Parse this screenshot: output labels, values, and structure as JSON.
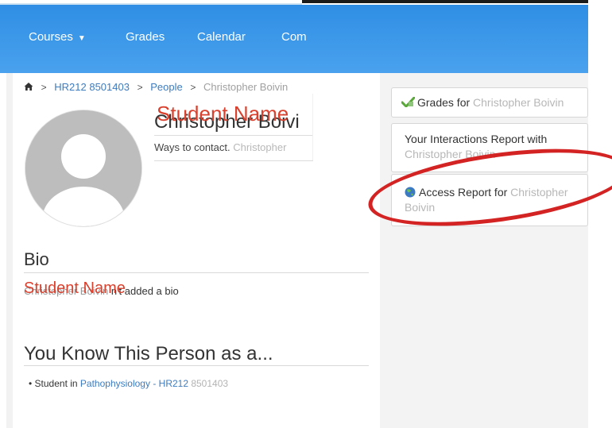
{
  "nav": {
    "courses_label": "Courses",
    "grades_label": "Grades",
    "calendar_label": "Calendar",
    "comm_label": "Com"
  },
  "breadcrumb": {
    "course": "HR212 8501403",
    "people": "People",
    "person": "Christopher Boivin"
  },
  "profile": {
    "name_under": "Christopher Boivi",
    "name_overlay": "Student Name",
    "contact_prefix": "Ways to contact",
    "contact_name": "Christopher"
  },
  "bio": {
    "heading": "Bio",
    "text_prefix": "Christopher Boivin",
    "text_suffix": "n't added a bio",
    "overlay": "Student Name"
  },
  "know": {
    "heading": "You Know This Person as a...",
    "item_prefix": "Student in ",
    "item_link": "Pathophysiology - HR212",
    "item_suffix": " 8501403"
  },
  "sidebar": {
    "grades_prefix": "Grades for ",
    "grades_name": "Christopher Boivin",
    "interactions_label": "Your Interactions Report with",
    "interactions_name": "Christopher Boivin",
    "access_prefix": "Access Report for ",
    "access_name_first": "Christopher",
    "access_name_last": "Boivin"
  },
  "colors": {
    "nav_blue": "#3a98e9",
    "link_blue": "#3c7cc0",
    "annotation_red": "#d42323"
  }
}
